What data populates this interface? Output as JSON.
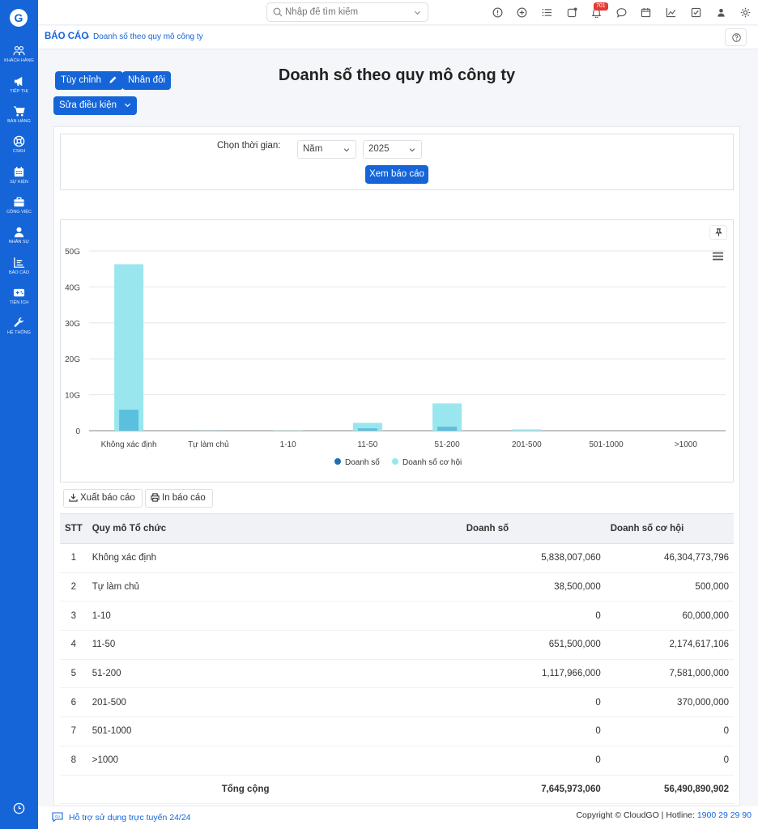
{
  "sidebar": {
    "logo": "G",
    "items": [
      {
        "label": "Khách hàng",
        "icon": "customers-icon"
      },
      {
        "label": "Tiếp thị",
        "icon": "megaphone-icon"
      },
      {
        "label": "Bán hàng",
        "icon": "cart-icon"
      },
      {
        "label": "CSKH",
        "icon": "support-icon"
      },
      {
        "label": "Sự kiện",
        "icon": "calendar-icon"
      },
      {
        "label": "Công việc",
        "icon": "briefcase-icon"
      },
      {
        "label": "Nhân sự",
        "icon": "person-icon"
      },
      {
        "label": "Báo cáo",
        "icon": "report-icon"
      },
      {
        "label": "Tiện ích",
        "icon": "utilities-icon"
      },
      {
        "label": "Hệ thống",
        "icon": "wrench-icon"
      }
    ]
  },
  "topbar": {
    "search_placeholder": "Nhập để tìm kiếm",
    "notification_count": "701"
  },
  "breadcrumb": {
    "root": "BÁO CÁO",
    "separator": "›",
    "current": "Doanh số theo quy mô công ty"
  },
  "header": {
    "title": "Doanh số theo quy mô công ty",
    "customize_label": "Tùy chỉnh",
    "duplicate_label": "Nhân đôi",
    "edit_conditions_label": "Sửa điều kiện"
  },
  "filter": {
    "time_label": "Chọn thời gian:",
    "period_value": "Năm",
    "year_value": "2025",
    "view_button": "Xem báo cáo"
  },
  "colors": {
    "primary": "#1565d8",
    "revenue_bar": "#5bc0de",
    "opportunity_bar": "#9ae6ee",
    "revenue_legend": "#1f6fb2"
  },
  "chart_data": {
    "type": "bar",
    "categories": [
      "Không xác định",
      "Tự làm chủ",
      "1-10",
      "11-50",
      "51-200",
      "201-500",
      "501-1000",
      ">1000"
    ],
    "series": [
      {
        "name": "Doanh số",
        "values": [
          5.838,
          0.0385,
          0,
          0.6515,
          1.118,
          0,
          0,
          0
        ]
      },
      {
        "name": "Doanh số cơ hội",
        "values": [
          46.305,
          0.0005,
          0.06,
          2.175,
          7.581,
          0.37,
          0,
          0
        ]
      }
    ],
    "y_ticks": [
      "0",
      "10G",
      "20G",
      "30G",
      "40G",
      "50G"
    ],
    "ylim": [
      0,
      50
    ],
    "grid": true,
    "legend_position": "bottom"
  },
  "actions": {
    "export_label": "Xuất báo cáo",
    "print_label": "In báo cáo"
  },
  "table": {
    "headers": {
      "stt": "STT",
      "name": "Quy mô Tổ chức",
      "revenue": "Doanh số",
      "opportunity": "Doanh số cơ hội"
    },
    "rows": [
      {
        "stt": "1",
        "name": "Không xác định",
        "revenue": "5,838,007,060",
        "opportunity": "46,304,773,796"
      },
      {
        "stt": "2",
        "name": "Tự làm chủ",
        "revenue": "38,500,000",
        "opportunity": "500,000"
      },
      {
        "stt": "3",
        "name": "1-10",
        "revenue": "0",
        "opportunity": "60,000,000"
      },
      {
        "stt": "4",
        "name": "11-50",
        "revenue": "651,500,000",
        "opportunity": "2,174,617,106"
      },
      {
        "stt": "5",
        "name": "51-200",
        "revenue": "1,117,966,000",
        "opportunity": "7,581,000,000"
      },
      {
        "stt": "6",
        "name": "201-500",
        "revenue": "0",
        "opportunity": "370,000,000"
      },
      {
        "stt": "7",
        "name": "501-1000",
        "revenue": "0",
        "opportunity": "0"
      },
      {
        "stt": "8",
        "name": ">1000",
        "revenue": "0",
        "opportunity": "0"
      }
    ],
    "total": {
      "label": "Tổng cộng",
      "revenue": "7,645,973,060",
      "opportunity": "56,490,890,902"
    }
  },
  "footer": {
    "support": "Hỗ trợ sử dụng trực tuyến 24/24",
    "copyright": "Copyright © CloudGO",
    "hotline_label": "Hotline:",
    "hotline": "1900 29 29 90"
  }
}
